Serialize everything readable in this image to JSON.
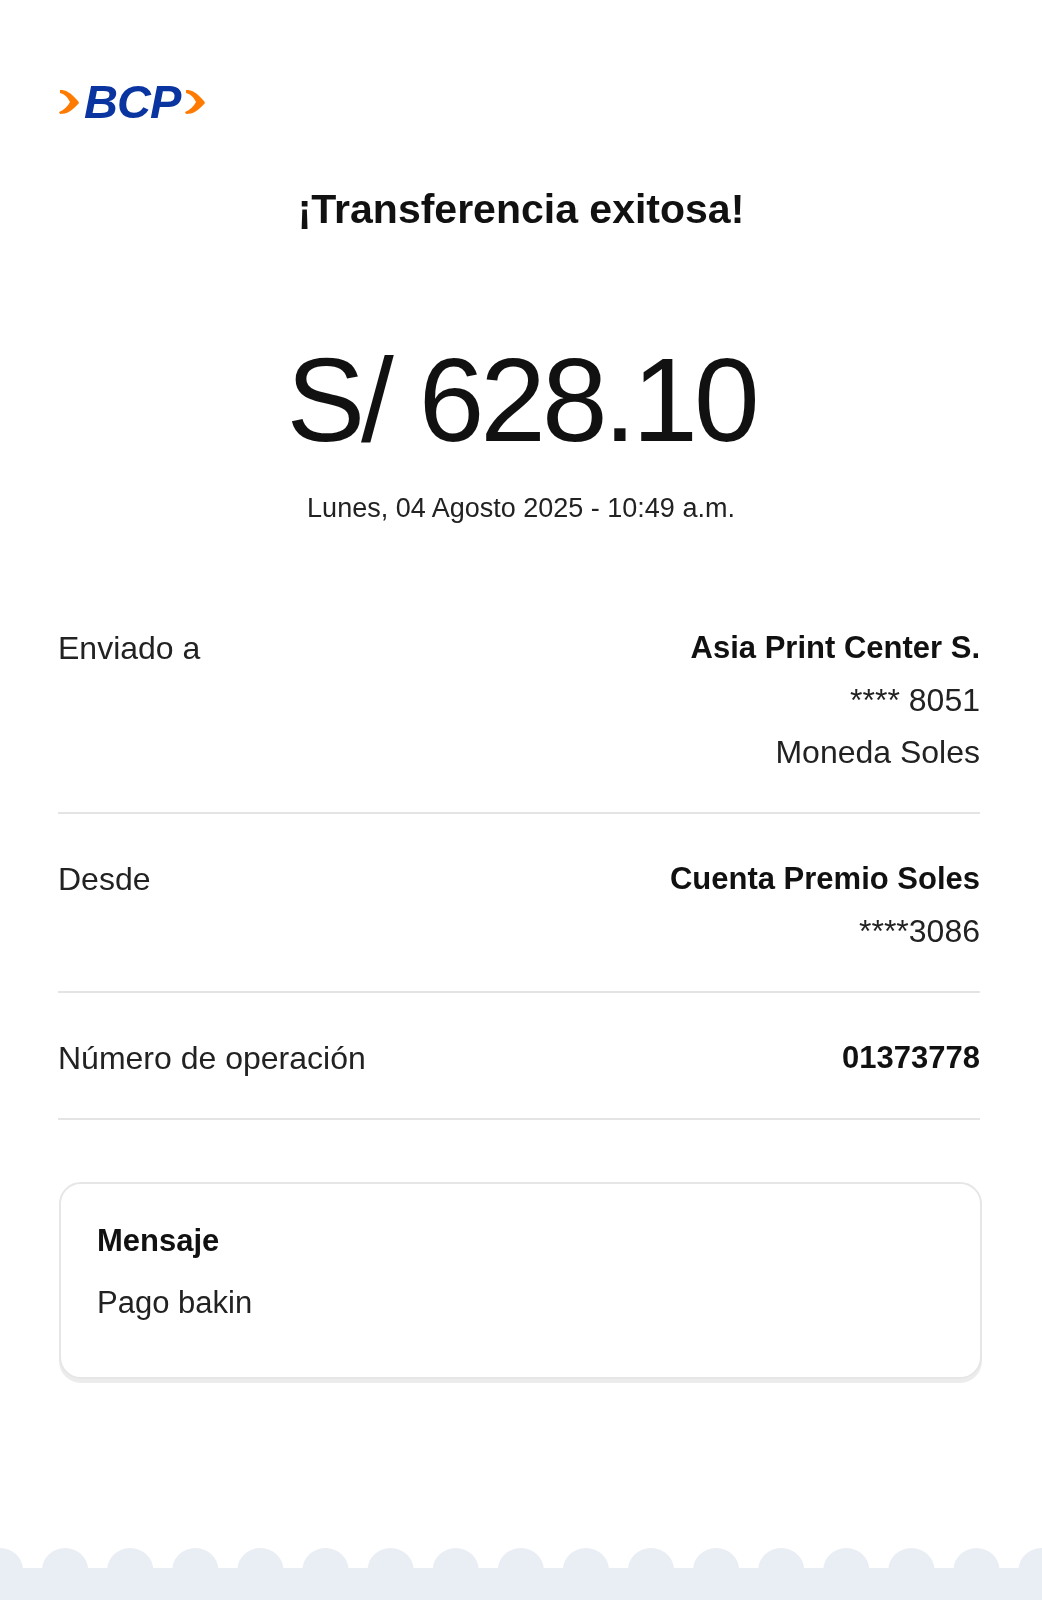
{
  "logo": {
    "text": "BCP"
  },
  "title": "¡Transferencia exitosa!",
  "amount": "S/ 628.10",
  "datetime": "Lunes, 04 Agosto 2025 - 10:49 a.m.",
  "details": [
    {
      "label": "Enviado a",
      "lines": [
        {
          "text": "Asia Print Center S.",
          "kind": "primary"
        },
        {
          "text": "**** 8051",
          "kind": "secondary"
        },
        {
          "text": "Moneda Soles",
          "kind": "secondary"
        }
      ]
    },
    {
      "label": "Desde",
      "lines": [
        {
          "text": "Cuenta Premio Soles",
          "kind": "primary"
        },
        {
          "text": "****3086",
          "kind": "secondary"
        }
      ]
    },
    {
      "label": "Número de operación",
      "lines": [
        {
          "text": "01373778",
          "kind": "primary"
        }
      ]
    }
  ],
  "message": {
    "heading": "Mensaje",
    "text": "Pago bakin"
  }
}
